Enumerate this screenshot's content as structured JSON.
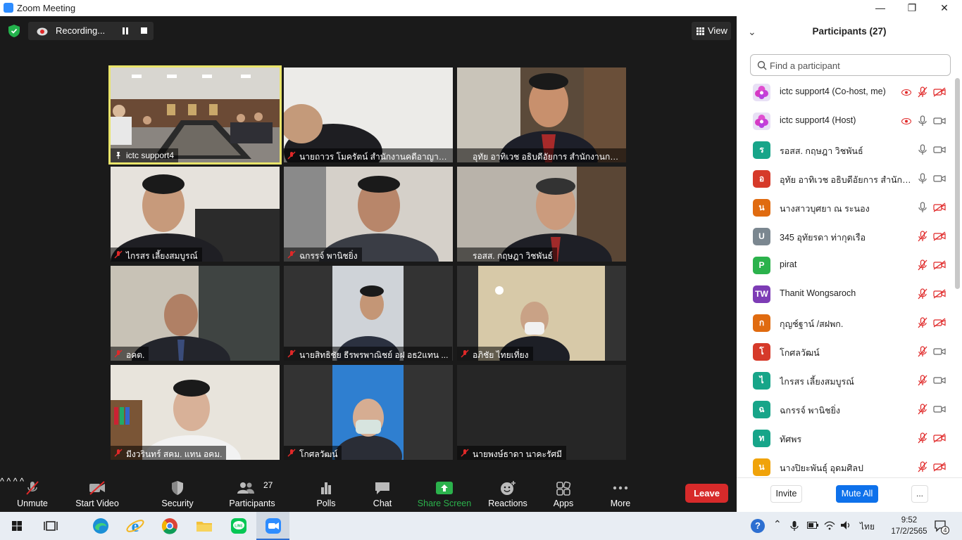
{
  "window": {
    "title": "Zoom Meeting",
    "minimize": "—",
    "restore": "❐",
    "close": "✕"
  },
  "meeting": {
    "recording_label": "Recording...",
    "view_label": "View",
    "tiles": [
      {
        "name": "ictc support4",
        "muted": false,
        "active": true,
        "pinned": true
      },
      {
        "name": "นายถาวร โมครัตน์ สำนักงานคดีอาญามีนบุรี",
        "muted": true
      },
      {
        "name": "อุทัย อาทิเวช อธิบดีอัยการ สำนักงานการสอบ...",
        "muted": false
      },
      {
        "name": "ไกรสร เลี้ยงสมบูรณ์",
        "muted": true
      },
      {
        "name": "ฉกรรจ์ พานิชยิ่ง",
        "muted": true
      },
      {
        "name": "รอสส. กฤษฎา วิชพันธ์",
        "muted": false
      },
      {
        "name": "อคต.",
        "muted": true
      },
      {
        "name": "นายสิทธิชัย ธีรพรพาณิชย์ อฝ อธ2แทน ...",
        "muted": true
      },
      {
        "name": "อภิชัย ไทยเที่ยง",
        "muted": true
      },
      {
        "name": "มีงวรินทร์ สคม. แทน อคม.",
        "muted": true
      },
      {
        "name": "โกศลวัฒน์",
        "muted": true
      },
      {
        "name": "นายพงษ์ธาดา นาคะรัศมี",
        "muted": true
      }
    ]
  },
  "toolbar": {
    "unmute": "Unmute",
    "start_video": "Start Video",
    "security": "Security",
    "participants": "Participants",
    "participants_count": "27",
    "polls": "Polls",
    "chat": "Chat",
    "share_screen": "Share Screen",
    "reactions": "Reactions",
    "apps": "Apps",
    "more": "More",
    "leave": "Leave"
  },
  "colors": {
    "active_border": "#e9e46a",
    "share_green": "#2bb24c",
    "leave_red": "#d72a2a",
    "mute_all_blue": "#0e71eb",
    "muted_red": "#e02828"
  },
  "panel": {
    "title": "Participants (27)",
    "search_placeholder": "Find a participant",
    "invite": "Invite",
    "mute_all": "Mute All",
    "more": "...",
    "participants": [
      {
        "name": "ictc support4 (Co-host, me)",
        "initial": "",
        "color": "#e8e0f5",
        "icon": "flower-avatar",
        "rec": true,
        "mic_muted": true,
        "cam_off": true
      },
      {
        "name": "ictc support4 (Host)",
        "initial": "",
        "color": "#e8e0f5",
        "icon": "flower-avatar",
        "rec": true,
        "mic_muted": false,
        "cam_off": false
      },
      {
        "name": "รอสส. กฤษฎา วิชพันธ์",
        "initial": "ร",
        "color": "#17a589",
        "mic_muted": false,
        "cam_off": false
      },
      {
        "name": "อุทัย อาทิเวช อธิบดีอัยการ สำนักงาน...",
        "initial": "อ",
        "color": "#d63a2a",
        "mic_muted": false,
        "cam_off": false
      },
      {
        "name": "นางสาวบุศยา ณ ระนอง",
        "initial": "น",
        "color": "#e06b10",
        "mic_muted": false,
        "cam_off": true
      },
      {
        "name": "345 อุทัยรดา ท่ากุดเรือ",
        "initial": "U",
        "color": "#7b8790",
        "mic_muted": true,
        "cam_off": true
      },
      {
        "name": "pirat",
        "initial": "P",
        "color": "#2bb24c",
        "mic_muted": true,
        "cam_off": true
      },
      {
        "name": "Thanit Wongsaroch",
        "initial": "TW",
        "color": "#7d3cb5",
        "mic_muted": true,
        "cam_off": true
      },
      {
        "name": "กุญช์ฐาน์ /สฝพก.",
        "initial": "ก",
        "color": "#e06b10",
        "mic_muted": true,
        "cam_off": true
      },
      {
        "name": "โกศลวัฒน์",
        "initial": "โ",
        "color": "#d63a2a",
        "mic_muted": true,
        "cam_off": false
      },
      {
        "name": "ไกรสร เลี้ยงสมบูรณ์",
        "initial": "ไ",
        "color": "#17a589",
        "mic_muted": true,
        "cam_off": false
      },
      {
        "name": "ฉกรรจ์ พานิชยิ่ง",
        "initial": "ฉ",
        "color": "#17a589",
        "mic_muted": true,
        "cam_off": false
      },
      {
        "name": "ทัศพร",
        "initial": "ท",
        "color": "#17a589",
        "mic_muted": true,
        "cam_off": true
      },
      {
        "name": "นางปิยะพันธุ์ อุดมศิลป",
        "initial": "น",
        "color": "#f0a30a",
        "mic_muted": true,
        "cam_off": true
      }
    ]
  },
  "taskbar": {
    "time": "9:52",
    "date": "17/2/2565",
    "lang": "ไทย",
    "notifications": "4",
    "help": "?"
  }
}
